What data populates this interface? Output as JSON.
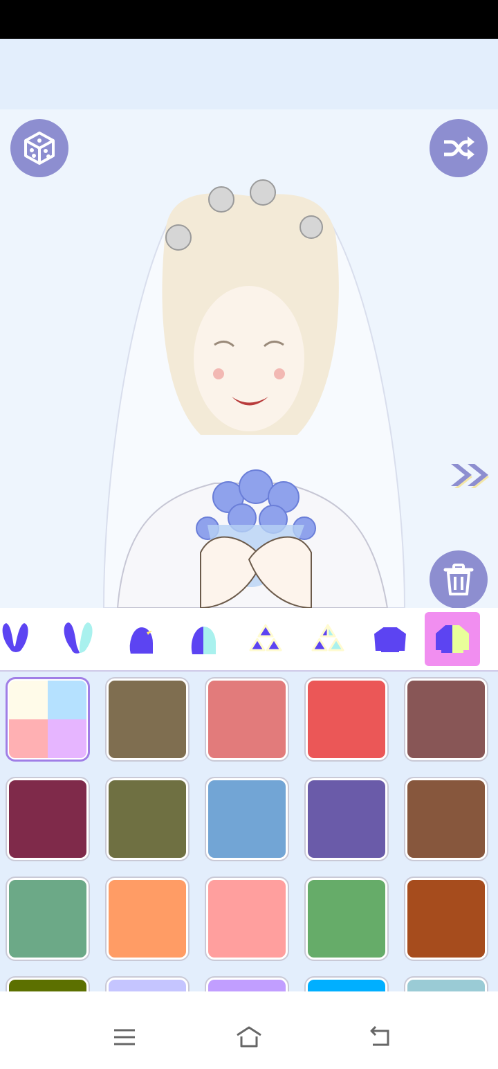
{
  "app": {
    "accent": "#8d8ed0",
    "tab_active_color": "#f18ef0",
    "canvas_bg": "#eef5fd",
    "palette_bg": "#e3eefc"
  },
  "buttons": {
    "random": {
      "icon": "dice-icon"
    },
    "shuffle": {
      "icon": "shuffle-icon"
    },
    "next": {
      "icon": "double-chevron-right-icon"
    },
    "delete": {
      "icon": "trash-icon"
    }
  },
  "character": {
    "icon": "bride-character-illustration"
  },
  "category_tabs": [
    {
      "name": "bunny-ears",
      "icon": "bunny-ears-icon",
      "active": false
    },
    {
      "name": "bunny-ears-color",
      "icon": "bunny-ears-half-icon",
      "active": false
    },
    {
      "name": "bird",
      "icon": "bird-icon",
      "active": false
    },
    {
      "name": "bird-color",
      "icon": "bird-half-icon",
      "active": false
    },
    {
      "name": "triangles",
      "icon": "triangles-icon",
      "active": false
    },
    {
      "name": "triangles-color",
      "icon": "triangles-half-icon",
      "active": false
    },
    {
      "name": "sweater",
      "icon": "sweater-icon",
      "active": false
    },
    {
      "name": "sweater-color",
      "icon": "sweater-half-icon",
      "active": true
    }
  ],
  "palette": {
    "multi_swatch": [
      "#fffbe9",
      "#b5e1ff",
      "#ffb0b3",
      "#e6b5ff"
    ],
    "colors": [
      "#7f6e50",
      "#e27b7b",
      "#eb5757",
      "#885656",
      "#7f2a4a",
      "#6f7042",
      "#72a5d5",
      "#6a5ba9",
      "#87573d",
      "#6ca987",
      "#ff9c65",
      "#ff9f9e",
      "#66ac69",
      "#a64c1d",
      "#5c7000",
      "#c5c5ff",
      "#c19eff",
      "#00afff",
      "#9acbd5"
    ]
  },
  "navigation": {
    "menu": {
      "icon": "menu-icon"
    },
    "home": {
      "icon": "home-icon"
    },
    "back": {
      "icon": "back-icon"
    }
  }
}
